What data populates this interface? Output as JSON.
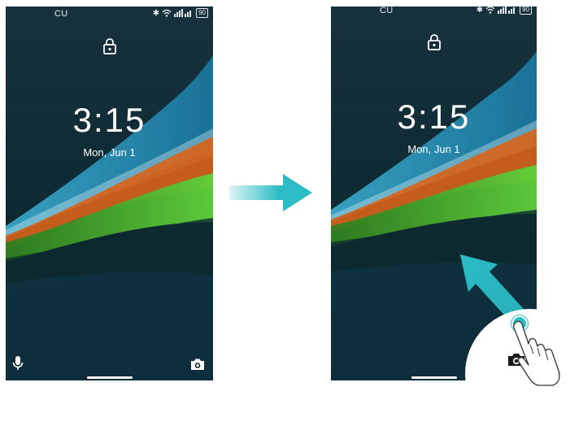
{
  "left_phone": {
    "carrier": "CU",
    "battery": "90",
    "time": "3:15",
    "date": "Mon, Jun 1"
  },
  "right_phone": {
    "carrier": "CU",
    "battery": "90",
    "time": "3:15",
    "date": "Mon, Jun 1"
  },
  "icons": {
    "lock": "lock-icon",
    "mic": "microphone-icon",
    "camera": "camera-icon",
    "bluetooth": "bluetooth-icon",
    "wifi": "wifi-icon",
    "signal": "signal-icon",
    "hand": "hand-pointer-icon"
  },
  "colors": {
    "arrow": "#2bbcc6",
    "wallpaper_blue": "#1a8fb8",
    "wallpaper_orange": "#d9621a",
    "wallpaper_green": "#3fae2a"
  }
}
